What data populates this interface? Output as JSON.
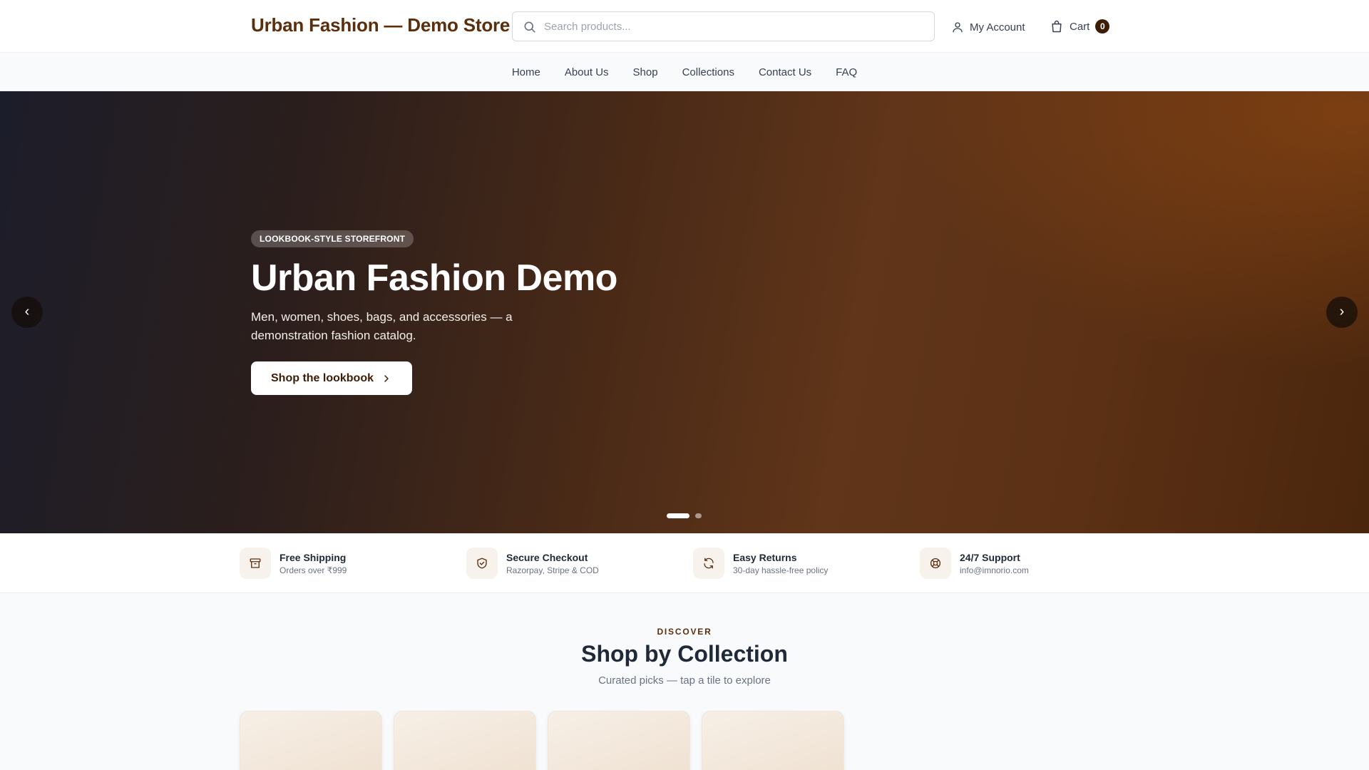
{
  "header": {
    "brand": "Urban Fashion — Demo Store",
    "search": {
      "placeholder": "Search products...",
      "value": ""
    },
    "account_label": "My Account",
    "cart_label": "Cart",
    "cart_count": "0"
  },
  "nav": {
    "items": [
      "Home",
      "About Us",
      "Shop",
      "Collections",
      "Contact Us",
      "FAQ"
    ]
  },
  "hero": {
    "tag": "LOOKBOOK-STYLE STOREFRONT",
    "title": "Urban Fashion Demo",
    "subtitle": "Men, women, shoes, bags, and accessories — a demonstration fashion catalog.",
    "cta_label": "Shop the lookbook",
    "prev_glyph": "‹",
    "next_glyph": "›",
    "slide_count": 2,
    "active_slide": 1
  },
  "features": [
    {
      "icon": "box-icon",
      "title": "Free Shipping",
      "subtitle": "Orders over ₹999"
    },
    {
      "icon": "shield-check-icon",
      "title": "Secure Checkout",
      "subtitle": "Razorpay, Stripe & COD"
    },
    {
      "icon": "refresh-icon",
      "title": "Easy Returns",
      "subtitle": "30-day hassle-free policy"
    },
    {
      "icon": "lifebuoy-icon",
      "title": "24/7 Support",
      "subtitle": "info@imnorio.com"
    }
  ],
  "collections": {
    "eyebrow": "DISCOVER",
    "title": "Shop by Collection",
    "subtitle": "Curated picks — tap a tile to explore",
    "tile_count": 4
  },
  "colors": {
    "brand": "#5b2e0c",
    "accent_dark": "#3d1d06",
    "feature_icon": "#5b2e0c"
  }
}
